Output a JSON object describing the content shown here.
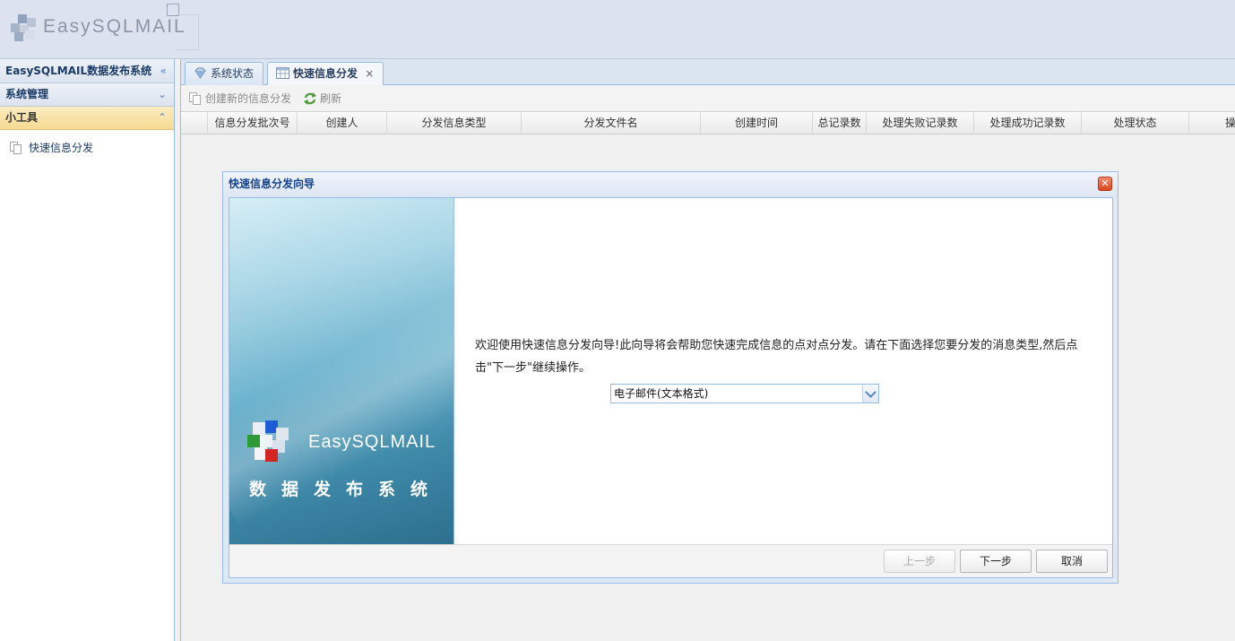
{
  "app": {
    "logo_text": "EasySQLMAIL"
  },
  "sidebar": {
    "title": "EasySQLMAIL数据发布系统",
    "sections": [
      {
        "label": "系统管理"
      },
      {
        "label": "小工具"
      }
    ],
    "items": [
      {
        "label": "快速信息分发"
      }
    ]
  },
  "tabs": [
    {
      "label": "系统状态"
    },
    {
      "label": "快速信息分发",
      "close": "×"
    }
  ],
  "toolbar": {
    "create_label": "创建新的信息分发",
    "refresh_label": "刷新"
  },
  "grid": {
    "columns": [
      "信息分发批次号",
      "创建人",
      "分发信息类型",
      "分发文件名",
      "创建时间",
      "总记录数",
      "处理失败记录数",
      "处理成功记录数",
      "处理状态",
      "操"
    ]
  },
  "dialog": {
    "title": "快速信息分发向导",
    "close_icon": "close-icon",
    "brand_name": "EasySQLMAIL",
    "brand_sub": "数据发布系统",
    "intro_text": "欢迎使用快速信息分发向导!此向导将会帮助您快速完成信息的点对点分发。请在下面选择您要分发的消息类型,然后点击\"下一步\"继续操作。",
    "message_type": "电子邮件(文本格式)",
    "buttons": {
      "prev": "上一步",
      "next": "下一步",
      "cancel": "取消"
    }
  }
}
